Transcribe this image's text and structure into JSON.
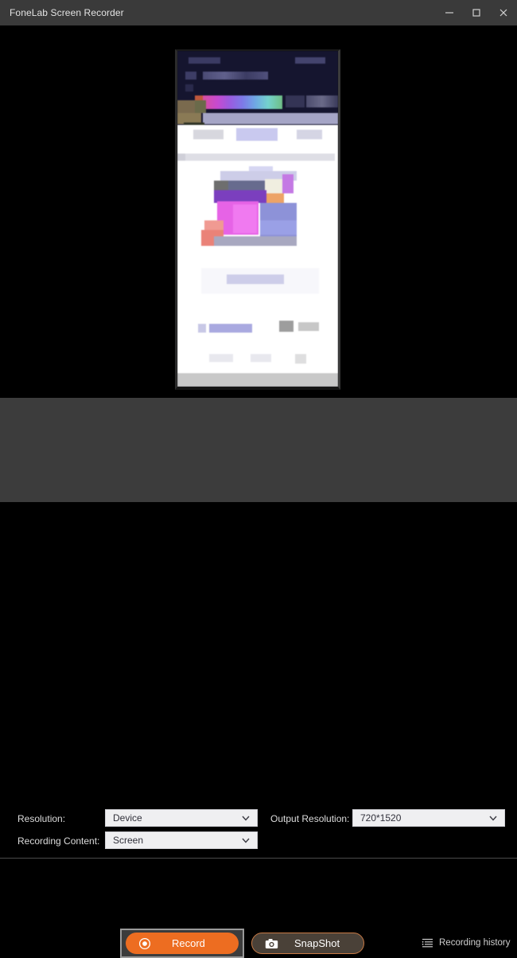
{
  "window": {
    "title": "FoneLab Screen Recorder",
    "controls": [
      {
        "name": "minimize",
        "glyph": "minimize-icon"
      },
      {
        "name": "maximize",
        "glyph": "maximize-icon"
      },
      {
        "name": "close",
        "glyph": "close-icon"
      }
    ]
  },
  "preview": {
    "description": "Blurred mirrored phone screen preview",
    "caption": "blurred-device-label"
  },
  "settings": {
    "resolution": {
      "label": "Resolution:",
      "value": "Device"
    },
    "recording_content": {
      "label": "Recording Content:",
      "value": "Screen"
    },
    "output_resolution": {
      "label": "Output Resolution:",
      "value": "720*1520"
    }
  },
  "actions": {
    "record": {
      "label": "Record",
      "icon": "record-circle-icon",
      "focused": true
    },
    "snapshot": {
      "label": "SnapShot",
      "icon": "camera-icon"
    },
    "history": {
      "label": "Recording history",
      "icon": "list-lines-icon"
    }
  },
  "colors": {
    "accent": "#ed6d21",
    "titlebar": "#3a3a3a",
    "panel": "#3c3c3c",
    "preview_bg": "#000000",
    "snapshot_border": "#c87a45"
  }
}
